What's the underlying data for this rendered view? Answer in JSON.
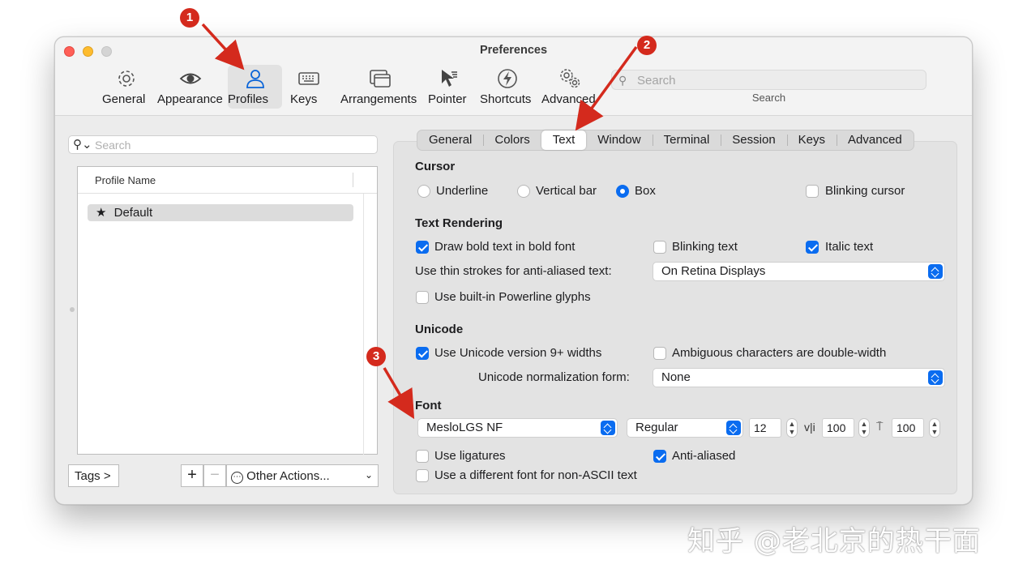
{
  "window": {
    "title": "Preferences"
  },
  "toolbar": {
    "items": [
      {
        "label": "General",
        "icon": "gear-icon"
      },
      {
        "label": "Appearance",
        "icon": "eye-icon"
      },
      {
        "label": "Profiles",
        "icon": "person-icon"
      },
      {
        "label": "Keys",
        "icon": "keyboard-icon"
      },
      {
        "label": "Arrangements",
        "icon": "windows-icon"
      },
      {
        "label": "Pointer",
        "icon": "pointer-icon"
      },
      {
        "label": "Shortcuts",
        "icon": "bolt-icon"
      },
      {
        "label": "Advanced",
        "icon": "gears-icon"
      }
    ],
    "active": "Profiles",
    "search_placeholder": "Search",
    "search_label": "Search"
  },
  "sidebar": {
    "search_placeholder": "Search",
    "column_header": "Profile Name",
    "profiles": [
      {
        "name": "Default",
        "icon": "★"
      }
    ],
    "tags_button": "Tags >",
    "add_button": "+",
    "remove_button": "−",
    "other_actions": "Other Actions...",
    "other_actions_icon": "⋯"
  },
  "tabs": {
    "items": [
      "General",
      "Colors",
      "Text",
      "Window",
      "Terminal",
      "Session",
      "Keys",
      "Advanced"
    ],
    "active": "Text"
  },
  "cursor": {
    "heading": "Cursor",
    "options": [
      "Underline",
      "Vertical bar",
      "Box"
    ],
    "selected": "Box",
    "blinking_label": "Blinking cursor",
    "blinking": false
  },
  "text_rendering": {
    "heading": "Text Rendering",
    "bold_label": "Draw bold text in bold font",
    "bold": true,
    "blinking_text_label": "Blinking text",
    "blinking_text": false,
    "italic_label": "Italic text",
    "italic": true,
    "thin_strokes_label": "Use thin strokes for anti-aliased text:",
    "thin_strokes_value": "On Retina Displays",
    "powerline_label": "Use built-in Powerline glyphs",
    "powerline": false
  },
  "unicode": {
    "heading": "Unicode",
    "widths_label": "Use Unicode version 9+ widths",
    "widths": true,
    "ambiguous_label": "Ambiguous characters are double-width",
    "ambiguous": false,
    "normalization_label": "Unicode normalization form:",
    "normalization_value": "None"
  },
  "font": {
    "heading": "Font",
    "family": "MesloLGS NF",
    "style": "Regular",
    "size": "12",
    "h_spacing_glyph": "v|i",
    "h_spacing": "100",
    "v_spacing_glyph": "⍑",
    "v_spacing": "100",
    "ligatures_label": "Use ligatures",
    "ligatures": false,
    "antialiased_label": "Anti-aliased",
    "antialiased": true,
    "non_ascii_label": "Use a different font for non-ASCII text",
    "non_ascii": false
  },
  "annotations": {
    "badges": [
      "1",
      "2",
      "3"
    ],
    "color": "#d42a1d"
  },
  "watermark": "知乎 @老北京的热干面",
  "colors": {
    "accent": "#0a6cf0",
    "annotation": "#d42a1d"
  }
}
